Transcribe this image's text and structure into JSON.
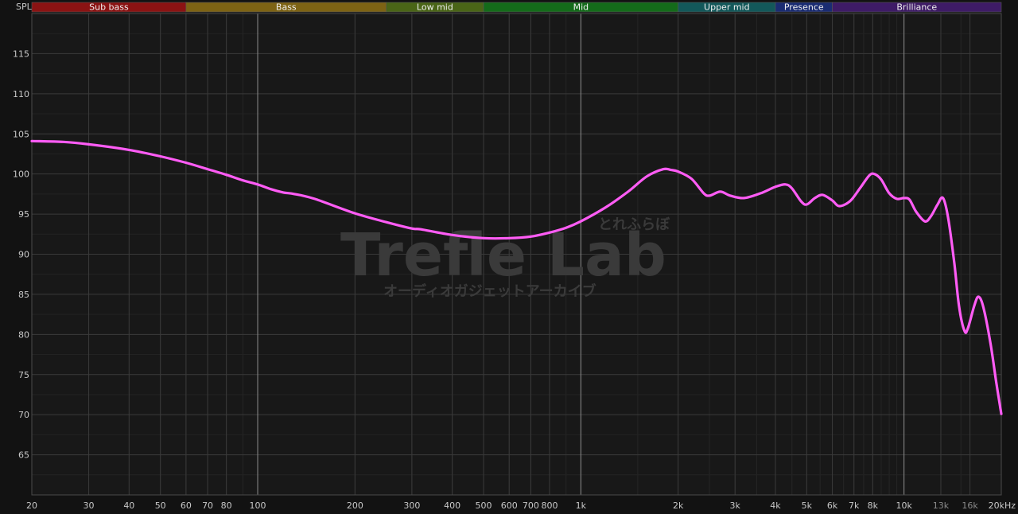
{
  "chart_data": {
    "type": "line",
    "ylabel": "SPL",
    "xscale": "log",
    "xlim": [
      20,
      20000
    ],
    "ylim": [
      60,
      120
    ],
    "grid": true,
    "x_ticks": [
      {
        "v": 20,
        "label": "20"
      },
      {
        "v": 30,
        "label": "30"
      },
      {
        "v": 40,
        "label": "40"
      },
      {
        "v": 50,
        "label": "50"
      },
      {
        "v": 60,
        "label": "60"
      },
      {
        "v": 70,
        "label": "70"
      },
      {
        "v": 80,
        "label": "80"
      },
      {
        "v": 100,
        "label": "100"
      },
      {
        "v": 200,
        "label": "200"
      },
      {
        "v": 300,
        "label": "300"
      },
      {
        "v": 400,
        "label": "400"
      },
      {
        "v": 500,
        "label": "500"
      },
      {
        "v": 600,
        "label": "600"
      },
      {
        "v": 700,
        "label": "700"
      },
      {
        "v": 800,
        "label": "800"
      },
      {
        "v": 1000,
        "label": "1k"
      },
      {
        "v": 2000,
        "label": "2k"
      },
      {
        "v": 3000,
        "label": "3k"
      },
      {
        "v": 4000,
        "label": "4k"
      },
      {
        "v": 5000,
        "label": "5k"
      },
      {
        "v": 6000,
        "label": "6k"
      },
      {
        "v": 7000,
        "label": "7k"
      },
      {
        "v": 8000,
        "label": "8k"
      },
      {
        "v": 10000,
        "label": "10k"
      },
      {
        "v": 13000,
        "label": "13k",
        "dim": true
      },
      {
        "v": 16000,
        "label": "16k",
        "dim": true
      },
      {
        "v": 20000,
        "label": "20kHz"
      }
    ],
    "y_ticks": [
      65,
      70,
      75,
      80,
      85,
      90,
      95,
      100,
      105,
      110,
      115
    ],
    "major_x": [
      100,
      1000,
      10000
    ],
    "bands": [
      {
        "name": "Sub bass",
        "from": 20,
        "to": 60,
        "color": "#8b1313"
      },
      {
        "name": "Bass",
        "from": 60,
        "to": 250,
        "color": "#7d6314"
      },
      {
        "name": "Low mid",
        "from": 250,
        "to": 500,
        "color": "#4a6517"
      },
      {
        "name": "Mid",
        "from": 500,
        "to": 2000,
        "color": "#146b1a"
      },
      {
        "name": "Upper mid",
        "from": 2000,
        "to": 4000,
        "color": "#13585a"
      },
      {
        "name": "Presence",
        "from": 4000,
        "to": 6000,
        "color": "#1a2c72"
      },
      {
        "name": "Brilliance",
        "from": 6000,
        "to": 20000,
        "color": "#3e1b66"
      }
    ],
    "series": [
      {
        "color": "#ff5cf5",
        "points": [
          [
            20,
            104.1
          ],
          [
            25,
            104.0
          ],
          [
            30,
            103.7
          ],
          [
            40,
            103.0
          ],
          [
            50,
            102.2
          ],
          [
            60,
            101.4
          ],
          [
            70,
            100.6
          ],
          [
            80,
            99.9
          ],
          [
            90,
            99.2
          ],
          [
            100,
            98.7
          ],
          [
            110,
            98.1
          ],
          [
            120,
            97.7
          ],
          [
            130,
            97.5
          ],
          [
            150,
            96.9
          ],
          [
            200,
            95.1
          ],
          [
            250,
            94.0
          ],
          [
            300,
            93.2
          ],
          [
            320,
            93.1
          ],
          [
            400,
            92.4
          ],
          [
            500,
            92.0
          ],
          [
            600,
            92.0
          ],
          [
            700,
            92.2
          ],
          [
            800,
            92.7
          ],
          [
            900,
            93.3
          ],
          [
            1000,
            94.1
          ],
          [
            1200,
            95.9
          ],
          [
            1400,
            97.8
          ],
          [
            1600,
            99.7
          ],
          [
            1800,
            100.6
          ],
          [
            1900,
            100.5
          ],
          [
            2000,
            100.3
          ],
          [
            2200,
            99.4
          ],
          [
            2400,
            97.6
          ],
          [
            2500,
            97.3
          ],
          [
            2700,
            97.8
          ],
          [
            2900,
            97.3
          ],
          [
            3200,
            97.0
          ],
          [
            3600,
            97.6
          ],
          [
            4000,
            98.4
          ],
          [
            4300,
            98.7
          ],
          [
            4500,
            98.2
          ],
          [
            4800,
            96.6
          ],
          [
            5000,
            96.2
          ],
          [
            5300,
            97.0
          ],
          [
            5600,
            97.4
          ],
          [
            6000,
            96.7
          ],
          [
            6300,
            96.0
          ],
          [
            6800,
            96.6
          ],
          [
            7300,
            98.2
          ],
          [
            7800,
            99.8
          ],
          [
            8100,
            100.0
          ],
          [
            8500,
            99.3
          ],
          [
            9000,
            97.6
          ],
          [
            9500,
            96.9
          ],
          [
            10000,
            97.0
          ],
          [
            10400,
            96.8
          ],
          [
            10900,
            95.3
          ],
          [
            11600,
            94.1
          ],
          [
            12100,
            94.7
          ],
          [
            12700,
            96.2
          ],
          [
            13200,
            97.0
          ],
          [
            13700,
            94.5
          ],
          [
            14300,
            89.0
          ],
          [
            14800,
            83.5
          ],
          [
            15400,
            80.4
          ],
          [
            15800,
            80.9
          ],
          [
            16500,
            83.6
          ],
          [
            17000,
            84.7
          ],
          [
            17600,
            83.4
          ],
          [
            18500,
            79.0
          ],
          [
            19300,
            74.0
          ],
          [
            20000,
            70.1
          ]
        ]
      }
    ]
  },
  "watermark": {
    "title": "Trefle Lab",
    "kana_top": "とれふらぼ",
    "subtitle": "オーディオガジェットアーカイブ"
  }
}
